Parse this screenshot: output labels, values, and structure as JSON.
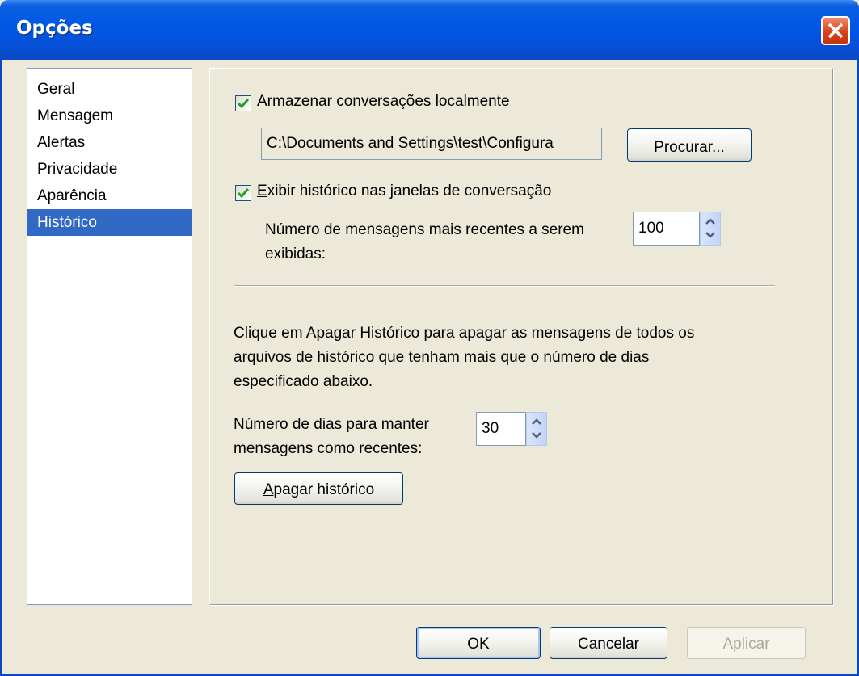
{
  "window": {
    "title": "Opções"
  },
  "sidebar": {
    "items": [
      {
        "label": "Geral"
      },
      {
        "label": "Mensagem"
      },
      {
        "label": "Alertas"
      },
      {
        "label": "Privacidade"
      },
      {
        "label": "Aparência"
      },
      {
        "label": "Histórico"
      }
    ],
    "selected": "Histórico"
  },
  "history": {
    "store_locally": {
      "checked": true,
      "label_pre": "Armazenar ",
      "label_ul": "c",
      "label_post": "onversações localmente"
    },
    "path_value": "C:\\Documents and Settings\\test\\Configura",
    "browse_button": {
      "ul": "P",
      "rest": "rocurar..."
    },
    "show_history": {
      "checked": true,
      "label_ul": "E",
      "label_post": "xibir histórico nas janelas de conversação"
    },
    "recent_count": {
      "label_line1": "Número de mensagens mais recentes a serem",
      "label_line2": "exibidas:",
      "value": "100"
    },
    "clear_info": {
      "line1": "Clique em Apagar Histórico para apagar as mensagens de todos os",
      "line2": "arquivos de histórico que tenham mais que o número de dias",
      "line3": "especificado abaixo."
    },
    "days": {
      "label_line1": "Número de dias para manter",
      "label_line2": "mensagens como recentes:",
      "value": "30"
    },
    "clear_button": {
      "ul": "A",
      "rest": "pagar histórico"
    }
  },
  "footer": {
    "ok_label": "OK",
    "cancel_label": "Cancelar",
    "apply_label": "Aplicar"
  },
  "colors": {
    "titlebar": "#0058e6",
    "selection": "#316ac5",
    "checkmark": "#21a121",
    "dialog_bg": "#ece9d8"
  }
}
